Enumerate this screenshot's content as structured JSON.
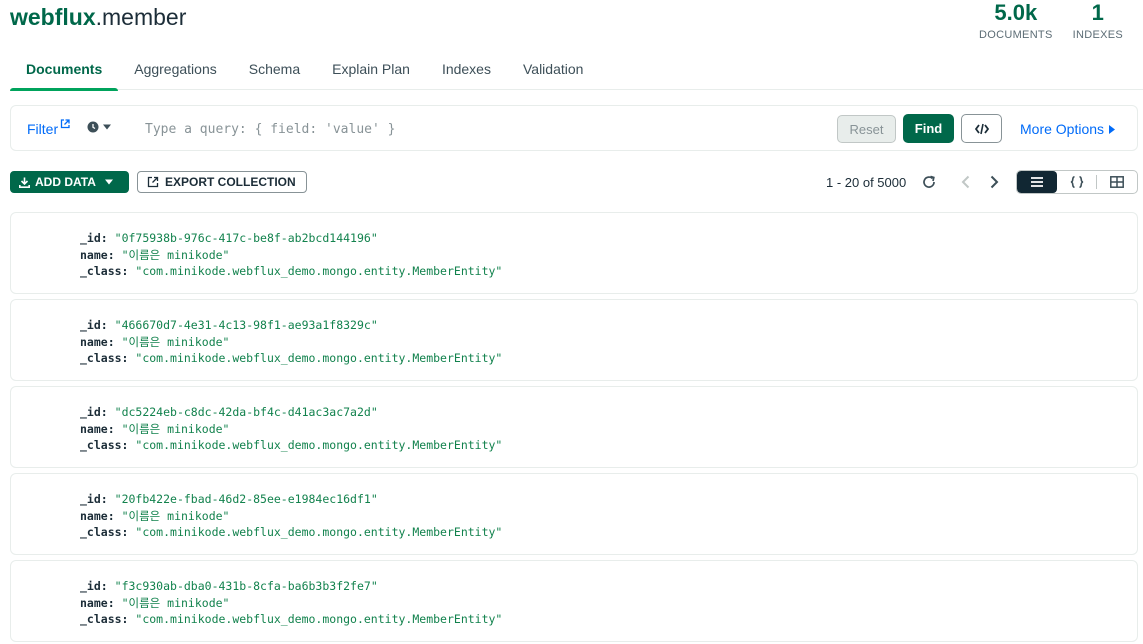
{
  "header": {
    "db_name": "webflux",
    "collection_name": ".member",
    "stats": [
      {
        "value": "5.0k",
        "label": "DOCUMENTS"
      },
      {
        "value": "1",
        "label": "INDEXES"
      }
    ]
  },
  "tabs": [
    {
      "label": "Documents",
      "active": true
    },
    {
      "label": "Aggregations"
    },
    {
      "label": "Schema"
    },
    {
      "label": "Explain Plan"
    },
    {
      "label": "Indexes"
    },
    {
      "label": "Validation"
    }
  ],
  "query_bar": {
    "filter_label": "Filter",
    "placeholder": "Type a query: { field: 'value' }",
    "reset_label": "Reset",
    "find_label": "Find",
    "more_options_label": "More Options"
  },
  "toolbar": {
    "add_data_label": "ADD DATA",
    "export_label": "EXPORT COLLECTION",
    "pagination": "1 - 20 of 5000"
  },
  "documents": [
    {
      "fields": [
        {
          "key": "_id:",
          "value": "\"0f75938b-976c-417c-be8f-ab2bcd144196\""
        },
        {
          "key": "name:",
          "value": "\"이름은 minikode\""
        },
        {
          "key": "_class:",
          "value": "\"com.minikode.webflux_demo.mongo.entity.MemberEntity\""
        }
      ]
    },
    {
      "fields": [
        {
          "key": "_id:",
          "value": "\"466670d7-4e31-4c13-98f1-ae93a1f8329c\""
        },
        {
          "key": "name:",
          "value": "\"이름은 minikode\""
        },
        {
          "key": "_class:",
          "value": "\"com.minikode.webflux_demo.mongo.entity.MemberEntity\""
        }
      ]
    },
    {
      "fields": [
        {
          "key": "_id:",
          "value": "\"dc5224eb-c8dc-42da-bf4c-d41ac3ac7a2d\""
        },
        {
          "key": "name:",
          "value": "\"이름은 minikode\""
        },
        {
          "key": "_class:",
          "value": "\"com.minikode.webflux_demo.mongo.entity.MemberEntity\""
        }
      ]
    },
    {
      "fields": [
        {
          "key": "_id:",
          "value": "\"20fb422e-fbad-46d2-85ee-e1984ec16df1\""
        },
        {
          "key": "name:",
          "value": "\"이름은 minikode\""
        },
        {
          "key": "_class:",
          "value": "\"com.minikode.webflux_demo.mongo.entity.MemberEntity\""
        }
      ]
    },
    {
      "fields": [
        {
          "key": "_id:",
          "value": "\"f3c930ab-dba0-431b-8cfa-ba6b3b3f2fe7\""
        },
        {
          "key": "name:",
          "value": "\"이름은 minikode\""
        },
        {
          "key": "_class:",
          "value": "\"com.minikode.webflux_demo.mongo.entity.MemberEntity\""
        }
      ]
    }
  ],
  "icons": {
    "filter": "external-link-icon",
    "history": "clock-icon",
    "code": "code-icon",
    "more": "caret-right-icon",
    "add": "download-icon",
    "export": "export-icon",
    "refresh": "refresh-icon",
    "prev": "chevron-left-icon",
    "next": "chevron-right-icon",
    "list_view": "list-view-icon",
    "json_view": "json-view-icon",
    "table_view": "table-view-icon"
  },
  "colors": {
    "brand_green": "#00684a",
    "link_blue": "#016bf8",
    "value_green": "#12824d",
    "tab_underline": "#00a35c"
  }
}
